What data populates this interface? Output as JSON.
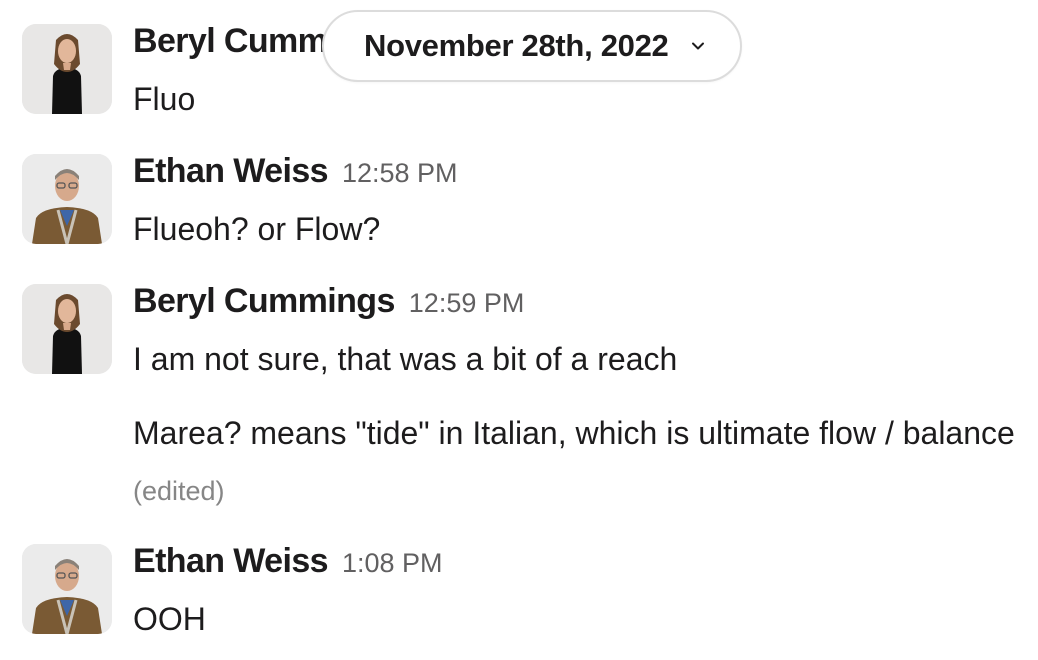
{
  "date_divider": {
    "label": "November 28th, 2022",
    "icon": "chevron-down-icon"
  },
  "messages": [
    {
      "author": "Beryl Cummings",
      "time": "",
      "avatar": "avatar-beryl-cummings",
      "lines": [
        "Fluo"
      ]
    },
    {
      "author": "Ethan Weiss",
      "time": "12:58 PM",
      "avatar": "avatar-ethan-weiss",
      "lines": [
        "Flueoh? or Flow?"
      ]
    },
    {
      "author": "Beryl Cummings",
      "time": "12:59 PM",
      "avatar": "avatar-beryl-cummings",
      "lines": [
        "I am not sure, that was a bit of a reach",
        "Marea? means \"tide\" in Italian, which is ultimate flow / balance"
      ],
      "edited_label": "(edited)"
    },
    {
      "author": "Ethan Weiss",
      "time": "1:08 PM",
      "avatar": "avatar-ethan-weiss",
      "lines": [
        "OOH"
      ]
    }
  ],
  "colors": {
    "text": "#1d1c1d",
    "timestamp": "#616061",
    "edited": "#868686",
    "pill_border": "#dcdcdc"
  }
}
